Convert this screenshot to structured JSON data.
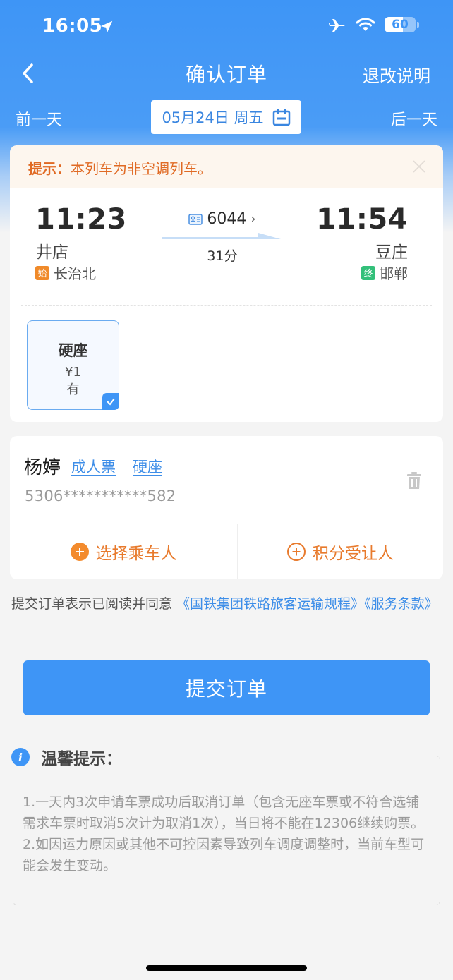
{
  "status_bar": {
    "time": "16:05",
    "battery": "60",
    "battery_level_percent": 60,
    "icons": [
      "location-arrow-icon",
      "airplane-icon",
      "wifi-icon",
      "battery-icon"
    ]
  },
  "nav": {
    "title": "确认订单",
    "right_link": "退改说明",
    "back_icon": "chevron-left-icon"
  },
  "date_bar": {
    "prev_day": "前一天",
    "next_day": "后一天",
    "date": "05月24日 周五",
    "calendar_icon": "calendar-icon"
  },
  "notice": {
    "label": "提示：",
    "text": "本列车为非空调列车。"
  },
  "train": {
    "departure_time": "11:23",
    "departure_station": "井店",
    "origin_badge": "始",
    "origin_station": "长治北",
    "arrival_time": "11:54",
    "arrival_station": "豆庄",
    "terminal_badge": "终",
    "terminal_station": "邯郸",
    "train_number": "6044",
    "duration": "31分"
  },
  "seats": [
    {
      "name": "硬座",
      "price": "¥1",
      "availability": "有",
      "selected": true
    }
  ],
  "passenger": {
    "name": "杨婷",
    "ticket_type": "成人票",
    "seat_type": "硬座",
    "id_number": "5306***********582"
  },
  "actions": {
    "select_passenger": "选择乘车人",
    "points_beneficiary": "积分受让人"
  },
  "agreement": {
    "prefix": "提交订单表示已阅读并同意 ",
    "link1": "《国铁集团铁路旅客运输规程》",
    "link2": "《服务条款》"
  },
  "submit_label": "提交订单",
  "tips": {
    "title": "温馨提示：",
    "items": [
      "1.一天内3次申请车票成功后取消订单（包含无座车票或不符合选铺需求车票时取消5次计为取消1次），当日将不能在12306继续购票。",
      "2.如因运力原因或其他不可控因素导致列车调度调整时，当前车型可能会发生变动。"
    ]
  },
  "colors": {
    "primary": "#3e95f6",
    "orange": "#e87a2c",
    "green_badge": "#33c07a",
    "notice_bg": "#fdf6ee"
  }
}
